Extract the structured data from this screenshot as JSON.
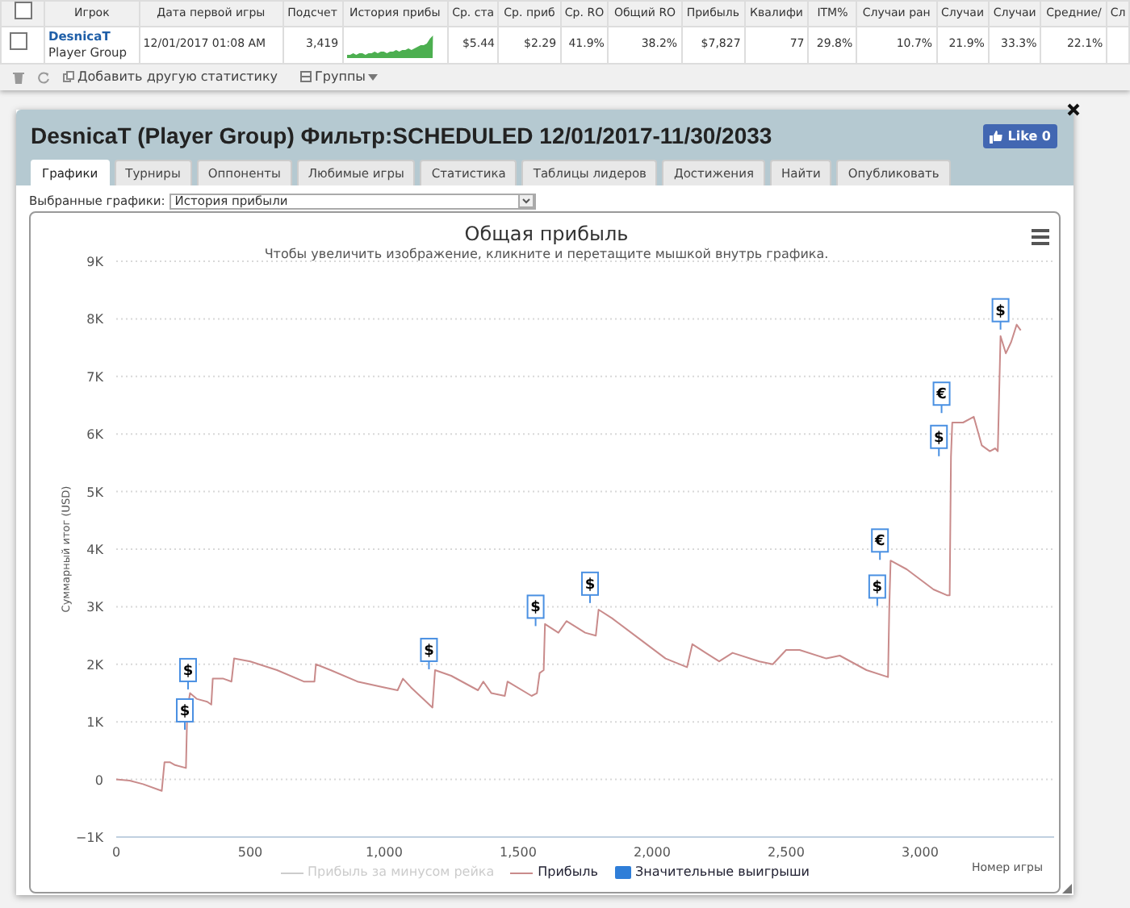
{
  "players_table": {
    "header_checked": false,
    "columns": [
      "Игрок",
      "Дата первой игры",
      "Подсчет",
      "История прибы",
      "Ср. ста",
      "Ср. приб",
      "Ср. RO",
      "Общий RO",
      "Прибыль",
      "Квалифи",
      "ITM%",
      "Случаи ран",
      "Случаи",
      "Случаи",
      "Средние/",
      "Сл"
    ],
    "rows": [
      {
        "selected": false,
        "cells": [
          {
            "kind": "player",
            "name": "DesnicaT",
            "group": "Player Group"
          },
          {
            "kind": "text",
            "text": "12/01/2017 01:08 AM"
          },
          {
            "kind": "text",
            "text": "3,419"
          },
          {
            "kind": "sparkline"
          },
          {
            "kind": "text",
            "text": "$5.44"
          },
          {
            "kind": "text",
            "text": "$2.29"
          },
          {
            "kind": "text",
            "text": "41.9%"
          },
          {
            "kind": "text",
            "text": "38.2%"
          },
          {
            "kind": "text",
            "text": "$7,827"
          },
          {
            "kind": "text",
            "text": "77"
          },
          {
            "kind": "text",
            "text": "29.8%"
          },
          {
            "kind": "text",
            "text": "10.7%"
          },
          {
            "kind": "text",
            "text": "21.9%"
          },
          {
            "kind": "text",
            "text": "33.3%"
          },
          {
            "kind": "text",
            "text": "22.1%"
          }
        ]
      }
    ]
  },
  "toolbar": {
    "add_stat": "Добавить другую статистику",
    "groups": "Группы"
  },
  "panel": {
    "title": "DesnicaT (Player Group) Фильтр:SCHEDULED 12/01/2017-11/30/2033",
    "like": "Like 0",
    "tabs": [
      {
        "label": "Графики",
        "selected": true
      },
      {
        "label": "Турниры",
        "selected": false
      },
      {
        "label": "Оппоненты",
        "selected": false
      },
      {
        "label": "Любимые игры",
        "selected": false
      },
      {
        "label": "Статистика",
        "selected": false
      },
      {
        "label": "Таблицы лидеров",
        "selected": false
      },
      {
        "label": "Достижения",
        "selected": false
      },
      {
        "label": "Найти",
        "selected": false
      },
      {
        "label": "Опубликовать",
        "selected": false
      }
    ],
    "chart_select": {
      "label": "Выбранные графики:",
      "value": "История прибыли"
    },
    "chart": {
      "subtitle": "Чтобы увеличить изображение, кликните и перетащите мышкой внутрь графика.",
      "legend": [
        {
          "label": "Прибыль за минусом рейка",
          "kind": "hidden_line",
          "color": "#cccccc"
        },
        {
          "kind": "series"
        },
        {
          "label": "Значительные выигрыши",
          "kind": "flags",
          "color": "#2f7ed8"
        }
      ],
      "flags": [
        {
          "label": "$"
        },
        {
          "label": "$"
        },
        {
          "label": "$"
        },
        {
          "label": "$"
        },
        {
          "label": "$"
        },
        {
          "label": "$"
        },
        {
          "label": "€"
        },
        {
          "label": "$"
        },
        {
          "label": "€"
        },
        {
          "label": "$"
        }
      ],
      "chart_data": {
        "type": "line",
        "title": "Общая прибыль",
        "xlabel": "Номер игры",
        "ylabel": "Суммарный итог (USD)",
        "x": [
          0,
          50,
          100,
          170,
          180,
          200,
          220,
          260,
          265,
          275,
          300,
          340,
          355,
          360,
          400,
          430,
          440,
          500,
          600,
          700,
          740,
          745,
          800,
          900,
          1000,
          1050,
          1070,
          1100,
          1180,
          1190,
          1250,
          1350,
          1370,
          1400,
          1450,
          1460,
          1550,
          1570,
          1580,
          1595,
          1600,
          1650,
          1680,
          1750,
          1790,
          1800,
          1850,
          1950,
          2050,
          2130,
          2150,
          2200,
          2250,
          2300,
          2400,
          2450,
          2500,
          2550,
          2650,
          2700,
          2800,
          2880,
          2885,
          2890,
          2950,
          3050,
          3100,
          3110,
          3115,
          3120,
          3160,
          3200,
          3230,
          3260,
          3280,
          3290,
          3300,
          3320,
          3340,
          3360,
          3375
        ],
        "series": [
          {
            "name": "Прибыль",
            "color": "#c98b8b",
            "values": [
              0,
              -20,
              -80,
              -200,
              300,
              300,
              250,
              200,
              1200,
              1500,
              1400,
              1350,
              1300,
              1750,
              1750,
              1700,
              2100,
              2050,
              1900,
              1700,
              1700,
              2000,
              1900,
              1700,
              1600,
              1550,
              1750,
              1600,
              1250,
              1900,
              1800,
              1550,
              1700,
              1500,
              1450,
              1700,
              1450,
              1500,
              1850,
              1900,
              2700,
              2550,
              2750,
              2550,
              2500,
              2950,
              2800,
              2450,
              2100,
              1950,
              2350,
              2200,
              2050,
              2200,
              2050,
              2000,
              2250,
              2250,
              2100,
              2150,
              1900,
              1780,
              3000,
              3800,
              3650,
              3300,
              3200,
              3200,
              5600,
              6200,
              6200,
              6300,
              5800,
              5700,
              5750,
              5700,
              7700,
              7400,
              7600,
              7900,
              7800
            ]
          }
        ],
        "xlim": [
          0,
          3500
        ],
        "ylim": [
          -1000,
          9000
        ],
        "grid": true,
        "xticks": [
          0,
          500,
          {
            "value": 1000,
            "label": "1,000"
          },
          {
            "value": 1500,
            "label": "1,500"
          },
          {
            "value": 2000,
            "label": "2,000"
          },
          {
            "value": 2500,
            "label": "2,500"
          },
          {
            "value": 3000,
            "label": "3,000"
          }
        ],
        "yticks": [
          {
            "value": -1000,
            "label": "−1K"
          },
          0,
          {
            "value": 1000,
            "label": "1K"
          },
          {
            "value": 2000,
            "label": "2K"
          },
          {
            "value": 3000,
            "label": "3K"
          },
          {
            "value": 4000,
            "label": "4K"
          },
          {
            "value": 5000,
            "label": "5K"
          },
          {
            "value": 6000,
            "label": "6K"
          },
          {
            "value": 7000,
            "label": "7K"
          },
          {
            "value": 8000,
            "label": "8K"
          },
          {
            "value": 9000,
            "label": "9K"
          }
        ]
      }
    }
  }
}
